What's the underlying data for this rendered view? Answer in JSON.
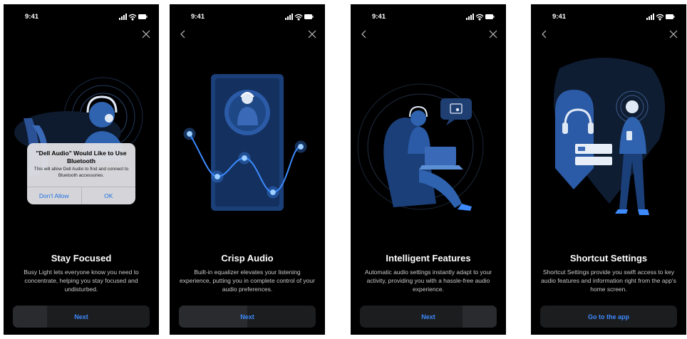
{
  "status": {
    "time": "9:41"
  },
  "screens": [
    {
      "title": "Stay Focused",
      "description": "Busy Light lets everyone know you need to concentrate, helping you stay focused and undisturbed.",
      "button": "Next",
      "has_back": false
    },
    {
      "title": "Crisp Audio",
      "description": "Built-in equalizer elevates your listening experience, putting you in complete control of your audio preferences.",
      "button": "Next",
      "has_back": true
    },
    {
      "title": "Intelligent Features",
      "description": "Automatic audio settings instantly adapt to your activity, providing you with a hassle-free audio experience.",
      "button": "Next",
      "has_back": true
    },
    {
      "title": "Shortcut Settings",
      "description": "Shortcut Settings provide you swift access to key audio features and information right from the app's home screen.",
      "button": "Go to the app",
      "has_back": true
    }
  ],
  "alert": {
    "title": "\"Dell Audio\" Would Like to Use Bluetooth",
    "message": "This will allow Dell Audio to find and connect to Bluetooth accessories.",
    "deny": "Don't Allow",
    "allow": "OK"
  },
  "icons": {
    "close": "close-icon",
    "back": "chevron-left-icon",
    "signal": "cellular-signal-icon",
    "wifi": "wifi-icon",
    "battery": "battery-icon"
  },
  "colors": {
    "background": "#000000",
    "accent": "#3d8bff",
    "illustration": "#2f63b0",
    "button_bg": "#1c1d1f"
  }
}
